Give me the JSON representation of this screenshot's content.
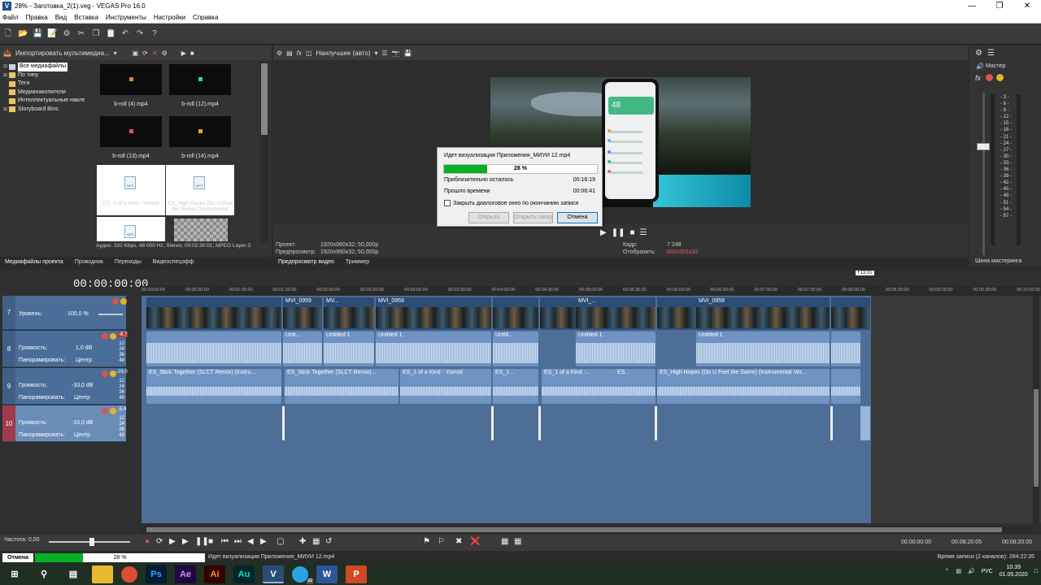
{
  "window": {
    "title": "28% - Заготовка_2(1).veg - VEGAS Pro 16.0",
    "app_icon": "V"
  },
  "menu": [
    "Файл",
    "Правка",
    "Вид",
    "Вставка",
    "Инструменты",
    "Настройки",
    "Справка"
  ],
  "media_panel": {
    "import_label": "Импортировать мультимедиа...",
    "tree": [
      {
        "label": "Все медиафайлы",
        "selected": true
      },
      {
        "label": "По типу"
      },
      {
        "label": "Теги"
      },
      {
        "label": "Медианакопители"
      },
      {
        "label": "Интеллектуальные наклейки"
      },
      {
        "label": "Storyboard Bins"
      }
    ],
    "thumbs": [
      {
        "caption": "b-roll (4).mp4",
        "color": "#d9822b"
      },
      {
        "caption": "b-roll (12).mp4",
        "color": "#2fd1a0"
      },
      {
        "caption": "b-roll (13).mp4",
        "color": "#e04b8f"
      },
      {
        "caption": "b-roll (14).mp4",
        "color": "#e6a227"
      }
    ],
    "audio_thumbs": [
      {
        "caption": "ES_1 of a Kind - Yomoti",
        "badge": "MP3"
      },
      {
        "caption": "ES_High Hopes (Do U Feel the Same) (Instrumental",
        "badge": "MP3"
      }
    ],
    "info": "Аудио: 320 Kbps, 48 000 Hz, Stereo; 00:02:30:01; MPEG Layer-3",
    "tabs": [
      "Медиафайлы проекта",
      "Проводник",
      "Переходы",
      "Видеоспецэфф"
    ]
  },
  "preview": {
    "quality": "Наилучшее (авто)",
    "project_label": "Проект:",
    "project_value": "1920x960x32; 50,000p",
    "preview_label": "Предпросмотр:",
    "preview_value": "1920x960x32; 50,000p",
    "frame_label": "Кадр:",
    "frame_value": "7 248",
    "display_label": "Отобразить:",
    "display_value": "602x301x32",
    "phone_value": "48",
    "tabs": [
      "Предпросмотр видео",
      "Триммер"
    ]
  },
  "render_dialog": {
    "title": "Идет визуализация Приложения_МИУИ 12.mp4",
    "progress": 28,
    "progress_label": "28 %",
    "remaining_label": "Приблизительно осталось",
    "remaining_value": "00:16:19",
    "elapsed_label": "Прошло времени",
    "elapsed_value": "00:06:41",
    "close_checkbox": "Закрыть диалоговое окно по окончанию записи",
    "btn_open": "Открыть",
    "btn_folder": "Открыть папку",
    "btn_cancel": "Отмена"
  },
  "master": {
    "label": "Мастер",
    "bus_tab": "Шина мастеринга",
    "meter_ticks": [
      "3",
      "6",
      "9",
      "12",
      "15",
      "18",
      "21",
      "24",
      "27",
      "30",
      "33",
      "36",
      "39",
      "42",
      "45",
      "48",
      "51",
      "54",
      "57"
    ]
  },
  "timeline": {
    "timecode": "00:00:00:00",
    "ruler": [
      "00:00:00:00",
      "00:00:30:00",
      "00:01:00:00",
      "00:01:30:00",
      "00:02:00:00",
      "00:02:30:00",
      "00:03:00:00",
      "00:03:30:00",
      "00:04:00:00",
      "00:04:30:00",
      "00:05:00:00",
      "00:05:30:00",
      "00:06:00:00",
      "00:06:30:00",
      "00:07:00:00",
      "00:07:30:00",
      "00:08:00:00",
      "00:08:30:00",
      "00:09:00:00",
      "00:09:30:00",
      "00:10:00:00"
    ],
    "end_marker": "+13:01",
    "tracks": [
      {
        "num": "7",
        "label": "Уровень:",
        "value": "100,0 %"
      },
      {
        "num": "8",
        "label": "Громкость:",
        "value": "1,0 dB",
        "pan_label": "Панорамировать:",
        "pan_value": "Центр",
        "level": "-8,7"
      },
      {
        "num": "9",
        "label": "Громкость:",
        "value": "-33,0 dB",
        "pan_label": "Панорамировать:",
        "pan_value": "Центр",
        "level": "-29,0"
      },
      {
        "num": "10",
        "label": "Громкость:",
        "value": "-10,0 dB",
        "pan_label": "Панорамировать:",
        "pan_value": "Центр",
        "level": "-5,4"
      }
    ],
    "video_clips": [
      "MVI_0959",
      "MV...",
      "MVI_0959",
      "MVI_...",
      "MVI_0959"
    ],
    "audio_clips": [
      "Unti...",
      "Untitled 1",
      "Untitled 1",
      "Untitl...",
      "Untitled 1",
      "Untitled 1"
    ],
    "music_clips": [
      "ES_Stick Together (SLCT Remix) (Instru...",
      "ES_Stick Together (SLCT Remix)...",
      "ES_1 of a Kind - Yomoti",
      "ES_1...",
      "ES_1 of a Kind -...",
      "ES...",
      "ES_High Hopes (Do U Feel the Same) (Instrumental Ver..."
    ],
    "level_meters": [
      "12",
      "24",
      "36",
      "48"
    ],
    "rate_label": "Частота: 0,00",
    "time_in": "00:00:00:00",
    "time_out": "00:08:20:05",
    "time_len": "00:08:20:05"
  },
  "status": {
    "cancel": "Отмена",
    "progress": 28,
    "progress_label": "28 %",
    "message": "Идет визуализация Приложения_МИУИ 12.mp4",
    "record_time": "Время записи (2 каналов): 284:22:35"
  },
  "taskbar": {
    "apps": [
      "Chrome",
      "Ps",
      "Ae",
      "Ai",
      "Au",
      "V",
      "Telegram",
      "W",
      "P"
    ],
    "telegram_badge": "22",
    "lang": "РУС",
    "time": "10:39",
    "date": "01.05.2020"
  }
}
